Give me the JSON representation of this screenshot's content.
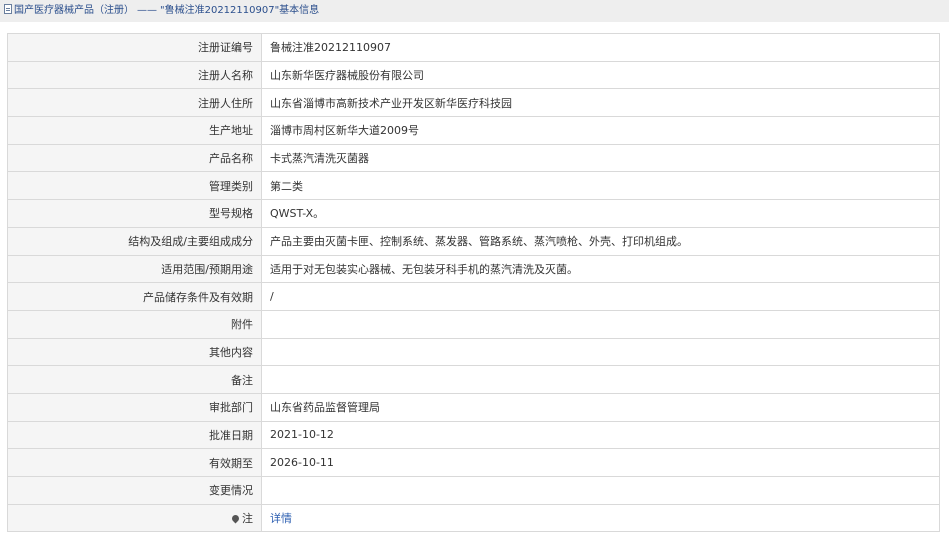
{
  "breadcrumb": {
    "root": "国产医疗器械产品（注册）",
    "separator": "——",
    "current": "\"鲁械注准20212110907\"基本信息"
  },
  "rows": [
    {
      "label": "注册证编号",
      "value": "鲁械注准20212110907"
    },
    {
      "label": "注册人名称",
      "value": "山东新华医疗器械股份有限公司"
    },
    {
      "label": "注册人住所",
      "value": "山东省淄博市高新技术产业开发区新华医疗科技园"
    },
    {
      "label": "生产地址",
      "value": "淄博市周村区新华大道2009号"
    },
    {
      "label": "产品名称",
      "value": "卡式蒸汽清洗灭菌器"
    },
    {
      "label": "管理类别",
      "value": "第二类"
    },
    {
      "label": "型号规格",
      "value": "QWST-X。"
    },
    {
      "label": "结构及组成/主要组成成分",
      "value": "产品主要由灭菌卡匣、控制系统、蒸发器、管路系统、蒸汽喷枪、外壳、打印机组成。"
    },
    {
      "label": "适用范围/预期用途",
      "value": "适用于对无包装实心器械、无包装牙科手机的蒸汽清洗及灭菌。"
    },
    {
      "label": "产品储存条件及有效期",
      "value": "/"
    },
    {
      "label": "附件",
      "value": ""
    },
    {
      "label": "其他内容",
      "value": ""
    },
    {
      "label": "备注",
      "value": ""
    },
    {
      "label": "审批部门",
      "value": "山东省药品监督管理局"
    },
    {
      "label": "批准日期",
      "value": "2021-10-12"
    },
    {
      "label": "有效期至",
      "value": "2026-10-11"
    },
    {
      "label": "变更情况",
      "value": ""
    }
  ],
  "note": {
    "label": "注",
    "icon": "pin-icon",
    "link_text": "详情"
  },
  "colors": {
    "link": "#2a5db0",
    "label_bg": "#f5f5f5",
    "border": "#d9d9d9",
    "crumb_bg": "#eeeeee"
  }
}
